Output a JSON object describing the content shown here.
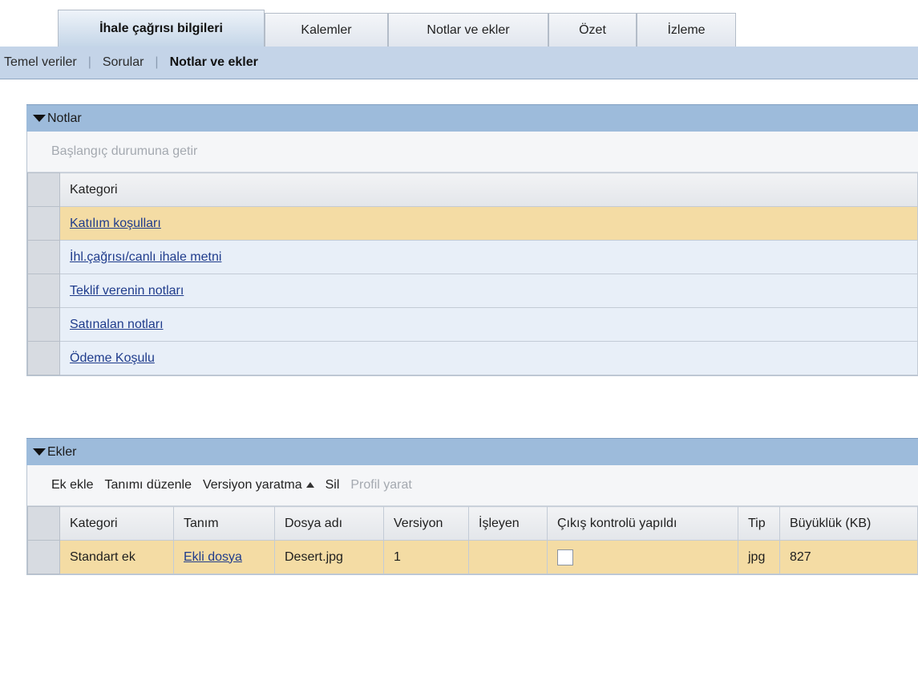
{
  "tabs": [
    {
      "label": "İhale çağrısı bilgileri",
      "active": true
    },
    {
      "label": "Kalemler",
      "active": false
    },
    {
      "label": "Notlar ve ekler",
      "active": false
    },
    {
      "label": "Özet",
      "active": false
    },
    {
      "label": "İzleme",
      "active": false
    }
  ],
  "subnav": {
    "items": [
      "Temel veriler",
      "Sorular",
      "Notlar ve ekler"
    ],
    "selected": "Notlar ve ekler"
  },
  "notes": {
    "title": "Notlar",
    "reset_label": "Başlangıç durumuna getir",
    "column": "Kategori",
    "rows": [
      "Katılım koşulları",
      "İhl.çağrısı/canlı ihale metni",
      "Teklif verenin notları",
      "Satınalan notları",
      "Ödeme Koşulu"
    ]
  },
  "attachments": {
    "title": "Ekler",
    "toolbar": {
      "add": "Ek ekle",
      "edit_desc": "Tanımı düzenle",
      "create_version": "Versiyon yaratma",
      "delete": "Sil",
      "create_profile": "Profil yarat"
    },
    "columns": [
      "Kategori",
      "Tanım",
      "Dosya adı",
      "Versiyon",
      "İşleyen",
      "Çıkış kontrolü yapıldı",
      "Tip",
      "Büyüklük (KB)"
    ],
    "row": {
      "category": "Standart ek",
      "description": "Ekli dosya",
      "filename": "Desert.jpg",
      "version": "1",
      "processor": "",
      "checked_out": false,
      "type": "jpg",
      "size_kb": "827"
    }
  },
  "colors": {
    "selected_row": "#f4dca4",
    "panel_header": "#9dbbdb",
    "link": "#1f3c8c"
  }
}
